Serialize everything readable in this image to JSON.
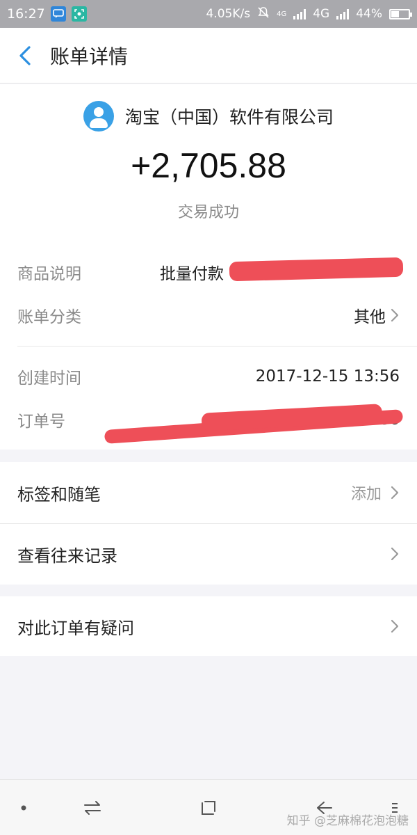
{
  "status_bar": {
    "time": "16:27",
    "net_speed": "4.05K/s",
    "network_small": "4G",
    "network": "4G",
    "battery": "44%",
    "battery_level": 0.44
  },
  "header": {
    "title": "账单详情"
  },
  "summary": {
    "merchant": "淘宝（中国）软件有限公司",
    "amount": "+2,705.88",
    "status": "交易成功"
  },
  "details": {
    "description_label": "商品说明",
    "description_value": "批量付款",
    "category_label": "账单分类",
    "category_value": "其他",
    "created_label": "创建时间",
    "created_value": "2017-12-15 13:56",
    "order_label": "订单号",
    "order_value_tail": "186"
  },
  "list": {
    "tags_label": "标签和随笔",
    "tags_action": "添加",
    "history_label": "查看往来记录",
    "question_label": "对此订单有疑问"
  },
  "watermark": "知乎 @芝麻棉花泡泡糖",
  "colors": {
    "accent": "#3aa1e6",
    "redaction": "#ee4f58"
  }
}
